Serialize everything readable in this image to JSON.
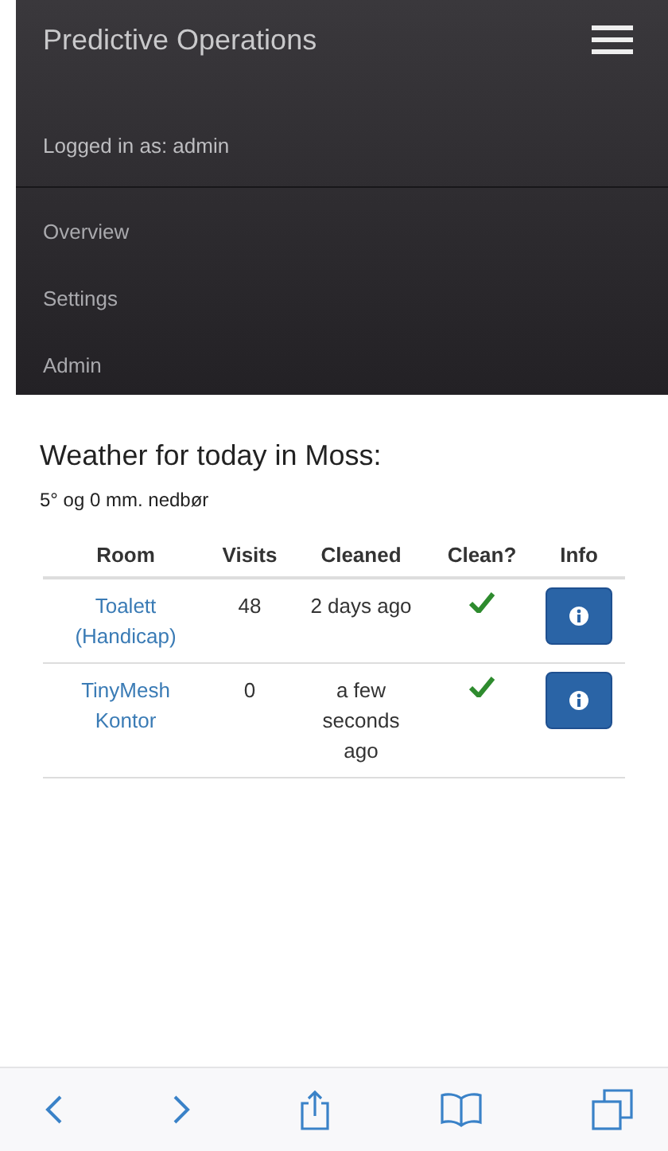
{
  "navbar": {
    "brand": "Predictive Operations",
    "user": "Logged in as: admin",
    "items": [
      {
        "label": "Overview"
      },
      {
        "label": "Settings"
      },
      {
        "label": "Admin"
      }
    ]
  },
  "weather": {
    "title": "Weather for today in Moss:",
    "summary": "5° og 0 mm. nedbør"
  },
  "table": {
    "columns": [
      "Room",
      "Visits",
      "Cleaned",
      "Clean?",
      "Info"
    ],
    "rows": [
      {
        "room": "Toalett (Handicap)",
        "visits": "48",
        "cleaned": "2 days ago",
        "clean": true
      },
      {
        "room": "TinyMesh Kontor",
        "visits": "0",
        "cleaned": "a few seconds ago",
        "clean": true
      }
    ]
  }
}
